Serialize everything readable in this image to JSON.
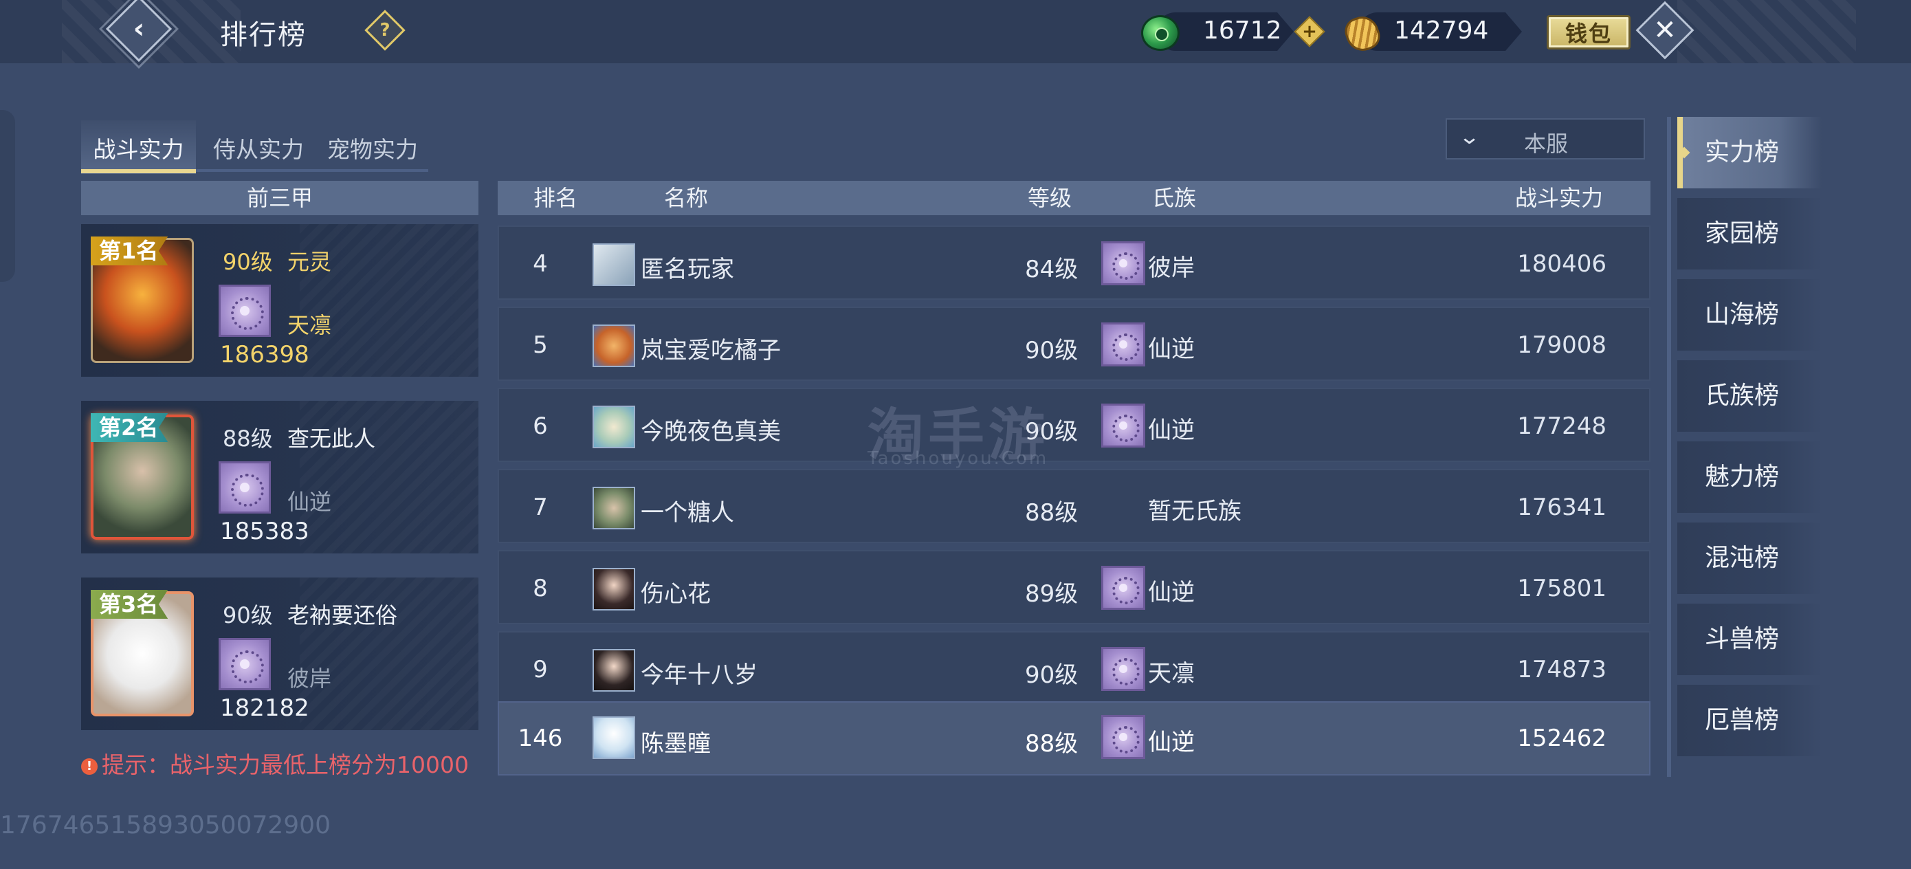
{
  "header": {
    "title": "排行榜",
    "jade_amount": "16712",
    "gold_amount": "142794",
    "wallet_label": "钱包"
  },
  "tabs": [
    {
      "label": "战斗实力",
      "active": true
    },
    {
      "label": "侍从实力",
      "active": false
    },
    {
      "label": "宠物实力",
      "active": false
    }
  ],
  "server_select": {
    "value": "本服"
  },
  "top3": {
    "heading": "前三甲",
    "cards": [
      {
        "rank_label": "第1名",
        "level": "90级",
        "name": "元灵",
        "clan": "天凛",
        "power": "186398"
      },
      {
        "rank_label": "第2名",
        "level": "88级",
        "name": "查无此人",
        "clan": "仙逆",
        "power": "185383"
      },
      {
        "rank_label": "第3名",
        "level": "90级",
        "name": "老衲要还俗",
        "clan": "彼岸",
        "power": "182182"
      }
    ],
    "tip": "提示：战斗实力最低上榜分为10000"
  },
  "table": {
    "headers": {
      "rank": "排名",
      "name": "名称",
      "level": "等级",
      "clan": "氏族",
      "power": "战斗实力"
    },
    "rows": [
      {
        "rank": "4",
        "name": "匿名玩家",
        "level": "84级",
        "clan": "彼岸",
        "power": "180406",
        "has_badge": true
      },
      {
        "rank": "5",
        "name": "岚宝爱吃橘子",
        "level": "90级",
        "clan": "仙逆",
        "power": "179008",
        "has_badge": true
      },
      {
        "rank": "6",
        "name": "今晚夜色真美",
        "level": "90级",
        "clan": "仙逆",
        "power": "177248",
        "has_badge": true
      },
      {
        "rank": "7",
        "name": "一个糖人",
        "level": "88级",
        "clan": "暂无氏族",
        "power": "176341",
        "has_badge": false
      },
      {
        "rank": "8",
        "name": "伤心花",
        "level": "89级",
        "clan": "仙逆",
        "power": "175801",
        "has_badge": true
      },
      {
        "rank": "9",
        "name": "今年十八岁",
        "level": "90级",
        "clan": "天凛",
        "power": "174873",
        "has_badge": true
      }
    ],
    "my_row": {
      "rank": "146",
      "name": "陈墨瞳",
      "level": "88级",
      "clan": "仙逆",
      "power": "152462"
    }
  },
  "right_menu": [
    {
      "label": "实力榜",
      "active": true
    },
    {
      "label": "家园榜",
      "active": false
    },
    {
      "label": "山海榜",
      "active": false
    },
    {
      "label": "氏族榜",
      "active": false
    },
    {
      "label": "魅力榜",
      "active": false
    },
    {
      "label": "混沌榜",
      "active": false
    },
    {
      "label": "斗兽榜",
      "active": false
    },
    {
      "label": "厄兽榜",
      "active": false
    }
  ],
  "watermark": {
    "main": "淘手游",
    "sub": "Taoshouyou.Com"
  },
  "user_id": "17674651589305007​2900",
  "colors": {
    "gold_text": "#f3d36a",
    "muted_text": "#9aa6b8",
    "tip_red": "#e9636a",
    "accent_gold": "#e7d58a"
  },
  "icons": [
    "back-icon",
    "help-icon",
    "jade-coin-icon",
    "plus-icon",
    "gold-ingot-icon",
    "close-icon",
    "chevron-down-icon",
    "clan-emblem-icon",
    "warning-icon"
  ]
}
